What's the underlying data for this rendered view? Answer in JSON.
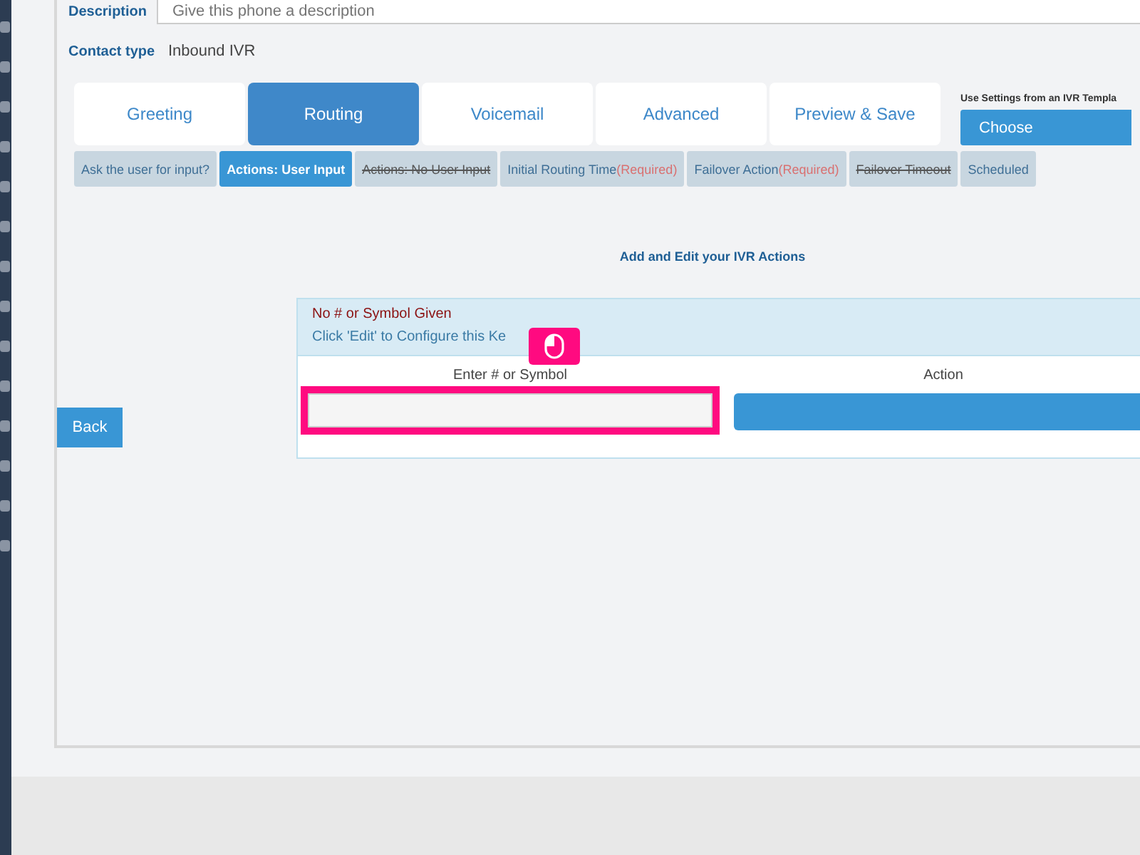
{
  "description": {
    "label": "Description",
    "placeholder": "Give this phone a description"
  },
  "contact_type": {
    "label": "Contact type",
    "value": "Inbound IVR"
  },
  "tabs": [
    {
      "label": "Greeting",
      "selected": false
    },
    {
      "label": "Routing",
      "selected": true
    },
    {
      "label": "Voicemail",
      "selected": false
    },
    {
      "label": "Advanced",
      "selected": false
    },
    {
      "label": "Preview & Save",
      "selected": false
    }
  ],
  "template": {
    "label": "Use Settings from an IVR Templa",
    "button": "Choose"
  },
  "subtabs": [
    {
      "label": "Ask the user for input?",
      "selected": false,
      "disabled": false
    },
    {
      "label": "Actions: User Input",
      "selected": true,
      "disabled": false
    },
    {
      "label": "Actions: No User Input",
      "selected": false,
      "disabled": true
    },
    {
      "label": "Initial Routing Time",
      "required": "(Required)",
      "selected": false,
      "disabled": false
    },
    {
      "label": "Failover Action",
      "required": "(Required)",
      "selected": false,
      "disabled": false
    },
    {
      "label": "Failover Timeout",
      "selected": false,
      "disabled": true
    },
    {
      "label": "Scheduled",
      "selected": false,
      "disabled": false
    }
  ],
  "section_title": "Add and Edit your IVR Actions",
  "back_button": "Back",
  "key_card": {
    "title": "No # or Symbol Given",
    "hint": "Click 'Edit' to Configure this Ke",
    "symbol_label": "Enter # or Symbol",
    "action_label": "Action"
  }
}
